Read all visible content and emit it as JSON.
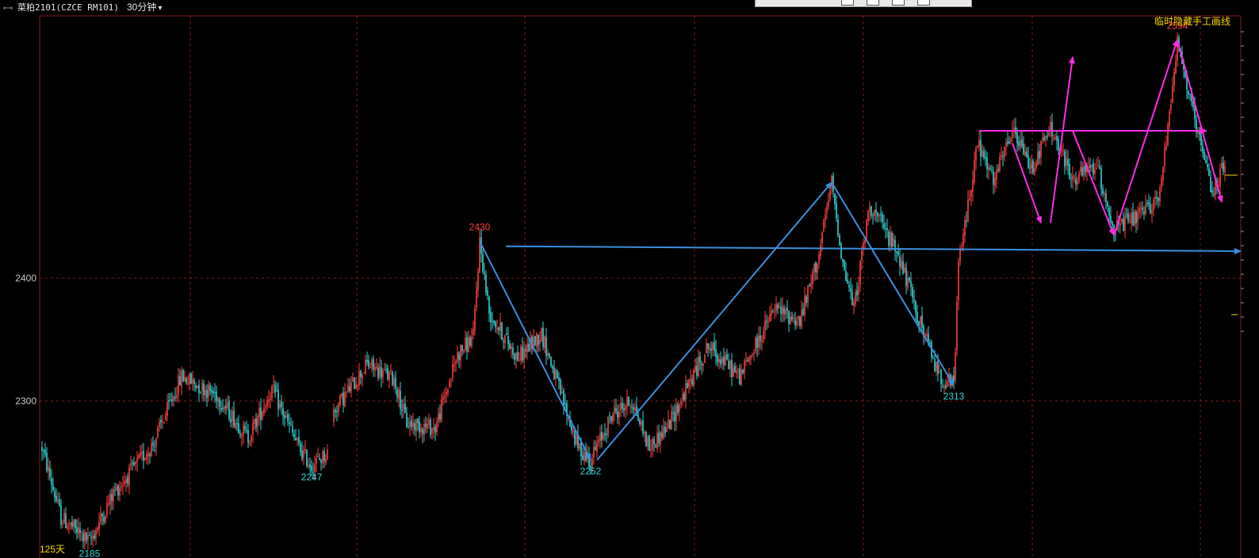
{
  "header": {
    "icon": "collapse-arrows-icon",
    "symbol_name": "菜粕2101(CZCE RM101)",
    "period": "30分钟",
    "period_dropdown_icon": "chevron-down-icon"
  },
  "toolbox": {
    "tools": [
      "tool-1",
      "tool-2",
      "tool-3",
      "tool-4"
    ]
  },
  "overlay": {
    "hide_manual_lines_label": "临时隐藏手工画线",
    "days_label": "125天"
  },
  "colors": {
    "background": "#000000",
    "grid": "#8b1a1a",
    "up_candle": "#ff4040",
    "down_candle": "#33d6d6",
    "peak_label": "#ff4040",
    "trough_label": "#33d6d6",
    "blue_line": "#3a8fe0",
    "magenta_line": "#ff2ce6",
    "yellow_label": "#ffd700",
    "axis_text": "#c8c8c8"
  },
  "chart_data": {
    "type": "candlestick",
    "y_axis_ticks": [
      2300,
      2400
    ],
    "ylim": [
      2180,
      2610
    ],
    "marked_extremes": [
      {
        "value": 2185,
        "kind": "low"
      },
      {
        "value": 2247,
        "kind": "low"
      },
      {
        "value": 2430,
        "kind": "high"
      },
      {
        "value": 2252,
        "kind": "low"
      },
      {
        "value": 2313,
        "kind": "low"
      },
      {
        "value": 2594,
        "kind": "high"
      }
    ],
    "price_path": [
      {
        "t": 0,
        "v": 2262
      },
      {
        "t": 12,
        "v": 2205
      },
      {
        "t": 24,
        "v": 2192
      },
      {
        "t": 30,
        "v": 2185
      },
      {
        "t": 45,
        "v": 2225
      },
      {
        "t": 70,
        "v": 2265
      },
      {
        "t": 88,
        "v": 2320
      },
      {
        "t": 110,
        "v": 2305
      },
      {
        "t": 130,
        "v": 2270
      },
      {
        "t": 145,
        "v": 2310
      },
      {
        "t": 162,
        "v": 2262
      },
      {
        "t": 170,
        "v": 2247
      },
      {
        "t": 180,
        "v": 2258
      },
      {
        "t": 184,
        "v": 2292
      },
      {
        "t": 205,
        "v": 2330
      },
      {
        "t": 222,
        "v": 2318
      },
      {
        "t": 230,
        "v": 2282
      },
      {
        "t": 248,
        "v": 2278
      },
      {
        "t": 262,
        "v": 2338
      },
      {
        "t": 272,
        "v": 2352
      },
      {
        "t": 276,
        "v": 2430
      },
      {
        "t": 282,
        "v": 2372
      },
      {
        "t": 300,
        "v": 2335
      },
      {
        "t": 315,
        "v": 2355
      },
      {
        "t": 338,
        "v": 2262
      },
      {
        "t": 346,
        "v": 2252
      },
      {
        "t": 360,
        "v": 2290
      },
      {
        "t": 372,
        "v": 2300
      },
      {
        "t": 383,
        "v": 2262
      },
      {
        "t": 395,
        "v": 2280
      },
      {
        "t": 420,
        "v": 2345
      },
      {
        "t": 440,
        "v": 2320
      },
      {
        "t": 462,
        "v": 2375
      },
      {
        "t": 478,
        "v": 2365
      },
      {
        "t": 490,
        "v": 2420
      },
      {
        "t": 498,
        "v": 2478
      },
      {
        "t": 505,
        "v": 2412
      },
      {
        "t": 512,
        "v": 2375
      },
      {
        "t": 522,
        "v": 2460
      },
      {
        "t": 540,
        "v": 2420
      },
      {
        "t": 552,
        "v": 2370
      },
      {
        "t": 566,
        "v": 2320
      },
      {
        "t": 575,
        "v": 2313
      },
      {
        "t": 578,
        "v": 2410
      },
      {
        "t": 590,
        "v": 2510
      },
      {
        "t": 600,
        "v": 2478
      },
      {
        "t": 612,
        "v": 2520
      },
      {
        "t": 624,
        "v": 2490
      },
      {
        "t": 636,
        "v": 2522
      },
      {
        "t": 650,
        "v": 2480
      },
      {
        "t": 665,
        "v": 2492
      },
      {
        "t": 676,
        "v": 2440
      },
      {
        "t": 694,
        "v": 2452
      },
      {
        "t": 705,
        "v": 2468
      },
      {
        "t": 716,
        "v": 2594
      },
      {
        "t": 728,
        "v": 2520
      },
      {
        "t": 738,
        "v": 2470
      },
      {
        "t": 744,
        "v": 2488
      }
    ],
    "drawings": [
      {
        "color": "blue",
        "from": [
          0.0,
          2426
        ],
        "to": [
          1.0,
          2422
        ],
        "arrow": true
      },
      {
        "color": "blue",
        "from": [
          276,
          2430
        ],
        "to": [
          346,
          2252
        ],
        "arrow": true
      },
      {
        "color": "blue",
        "from": [
          350,
          2252
        ],
        "to": [
          498,
          2478
        ],
        "arrow": true
      },
      {
        "color": "blue",
        "from": [
          498,
          2478
        ],
        "to": [
          575,
          2313
        ],
        "arrow": true
      },
      {
        "color": "magenta",
        "from": [
          0.0,
          2520
        ],
        "to": [
          1.0,
          2520
        ],
        "arrow": true
      },
      {
        "color": "magenta",
        "from": [
          612,
          2510
        ],
        "to": [
          630,
          2445
        ],
        "arrow": true
      },
      {
        "color": "magenta",
        "from": [
          636,
          2445
        ],
        "to": [
          650,
          2580
        ],
        "arrow": true
      },
      {
        "color": "magenta",
        "from": [
          650,
          2520
        ],
        "to": [
          676,
          2435
        ],
        "arrow": true
      },
      {
        "color": "magenta",
        "from": [
          676,
          2435
        ],
        "to": [
          716,
          2594
        ],
        "arrow": true
      },
      {
        "color": "magenta",
        "from": [
          716,
          2594
        ],
        "to": [
          744,
          2462
        ],
        "arrow": true
      }
    ]
  }
}
